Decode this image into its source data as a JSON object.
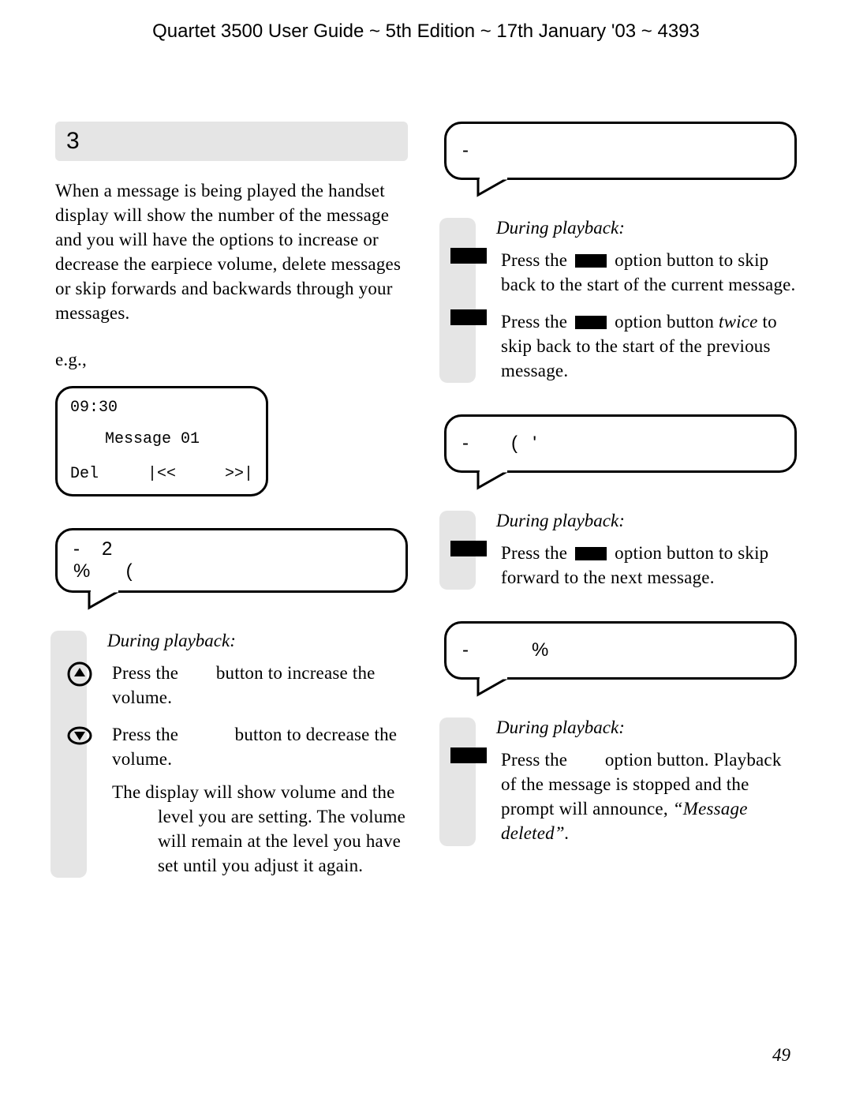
{
  "header": "Quartet 3500 User Guide ~ 5th Edition ~ 17th January '03 ~ 4393",
  "page_number": "49",
  "left": {
    "section_number": "3",
    "intro": "When a message is being played the handset display will show the number of the message and you will have the options to increase or decrease the earpiece volume, delete messages or skip forwards and backwards through your messages.",
    "eg": "e.g.,",
    "lcd": {
      "time": "09:30",
      "msg": "Message 01",
      "s1": "Del",
      "s2": "|<<",
      "s3": ">>|"
    },
    "bubble1": "-   2\n%     (",
    "dp": "During playback:",
    "up_pre": "Press the ",
    "up_post": " button to increase the volume.",
    "down_pre": "Press the ",
    "down_post": " button to decrease the volume.",
    "vol_note": "The display will show volume and the level you are setting. The volume will remain at the level you have set until you adjust it again."
  },
  "right": {
    "b1": "-",
    "dp1": "During playback:",
    "r1a_pre": "Press the ",
    "r1a_post": " option button to skip back to the start of the current message.",
    "r1b_pre": "Press the ",
    "r1b_mid": " option button ",
    "r1b_tw": "twice",
    "r1b_post": " to skip back to the start of the previous message.",
    "b2": "-      (  '",
    "dp2": "During playback:",
    "r2_pre": "Press the ",
    "r2_post": " option button to skip forward to the next message.",
    "b3": "-         %",
    "dp3": "During playback:",
    "r3_pre": "Press the ",
    "r3_mid": " option button. Playback of the message is stopped and the prompt will announce, ",
    "r3_q": "“Message deleted”."
  }
}
